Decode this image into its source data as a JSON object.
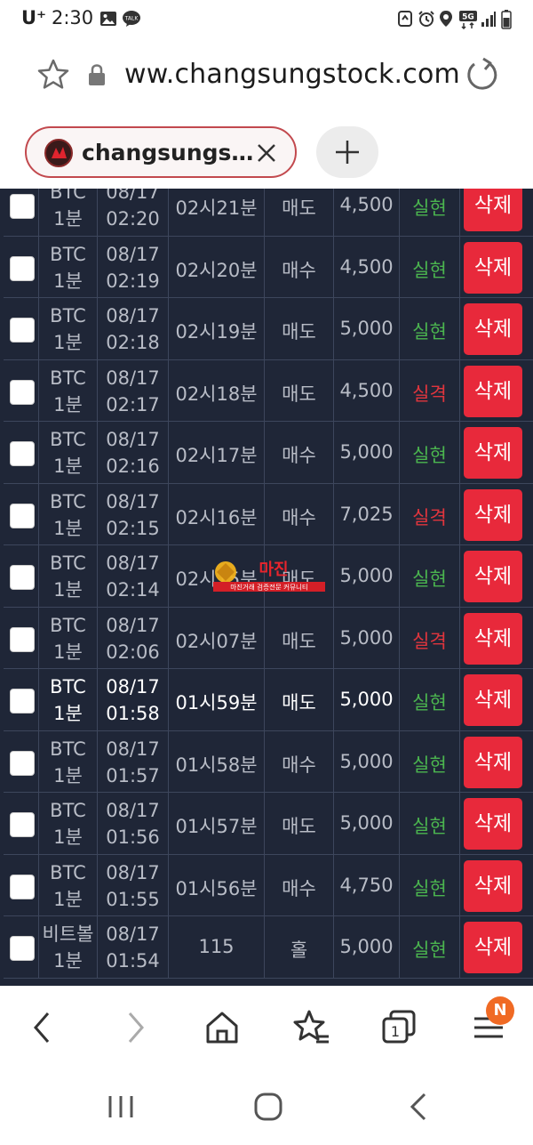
{
  "status_bar": {
    "carrier": "U⁺",
    "time": "2:30",
    "icons": [
      "gallery-icon",
      "talk-icon",
      "sync-icon",
      "alarm-icon",
      "location-icon",
      "5g-icon",
      "signal-icon",
      "battery-icon"
    ],
    "network": "5G"
  },
  "browser": {
    "url": "ww.changsungstock.com",
    "tab_title": "changsungs…"
  },
  "table": {
    "rows": [
      {
        "coin": "BTC",
        "interval": "1분",
        "date": "08/17",
        "time": "02:20",
        "round": "02시21분",
        "position": "매도",
        "amount": "4,500",
        "result": "실현",
        "result_status": "ok",
        "delete": "삭제"
      },
      {
        "coin": "BTC",
        "interval": "1분",
        "date": "08/17",
        "time": "02:19",
        "round": "02시20분",
        "position": "매수",
        "amount": "4,500",
        "result": "실현",
        "result_status": "ok",
        "delete": "삭제"
      },
      {
        "coin": "BTC",
        "interval": "1분",
        "date": "08/17",
        "time": "02:18",
        "round": "02시19분",
        "position": "매도",
        "amount": "5,000",
        "result": "실현",
        "result_status": "ok",
        "delete": "삭제"
      },
      {
        "coin": "BTC",
        "interval": "1분",
        "date": "08/17",
        "time": "02:17",
        "round": "02시18분",
        "position": "매도",
        "amount": "4,500",
        "result": "실격",
        "result_status": "fail",
        "delete": "삭제"
      },
      {
        "coin": "BTC",
        "interval": "1분",
        "date": "08/17",
        "time": "02:16",
        "round": "02시17분",
        "position": "매수",
        "amount": "5,000",
        "result": "실현",
        "result_status": "ok",
        "delete": "삭제"
      },
      {
        "coin": "BTC",
        "interval": "1분",
        "date": "08/17",
        "time": "02:15",
        "round": "02시16분",
        "position": "매수",
        "amount": "7,025",
        "result": "실격",
        "result_status": "fail",
        "delete": "삭제"
      },
      {
        "coin": "BTC",
        "interval": "1분",
        "date": "08/17",
        "time": "02:14",
        "round": "02시15분",
        "position": "매도",
        "amount": "5,000",
        "result": "실현",
        "result_status": "ok",
        "delete": "삭제"
      },
      {
        "coin": "BTC",
        "interval": "1분",
        "date": "08/17",
        "time": "02:06",
        "round": "02시07분",
        "position": "매도",
        "amount": "5,000",
        "result": "실격",
        "result_status": "fail",
        "delete": "삭제"
      },
      {
        "coin": "BTC",
        "interval": "1분",
        "date": "08/17",
        "time": "01:58",
        "round": "01시59분",
        "position": "매도",
        "amount": "5,000",
        "result": "실현",
        "result_status": "ok",
        "delete": "삭제",
        "highlight": true
      },
      {
        "coin": "BTC",
        "interval": "1분",
        "date": "08/17",
        "time": "01:57",
        "round": "01시58분",
        "position": "매수",
        "amount": "5,000",
        "result": "실현",
        "result_status": "ok",
        "delete": "삭제"
      },
      {
        "coin": "BTC",
        "interval": "1분",
        "date": "08/17",
        "time": "01:56",
        "round": "01시57분",
        "position": "매도",
        "amount": "5,000",
        "result": "실현",
        "result_status": "ok",
        "delete": "삭제"
      },
      {
        "coin": "BTC",
        "interval": "1분",
        "date": "08/17",
        "time": "01:55",
        "round": "01시56분",
        "position": "매수",
        "amount": "4,750",
        "result": "실현",
        "result_status": "ok",
        "delete": "삭제"
      },
      {
        "coin": "비트볼",
        "interval": "1분",
        "date": "08/17",
        "time": "01:54",
        "round": "115",
        "position": "홀",
        "amount": "5,000",
        "result": "실현",
        "result_status": "ok",
        "delete": "삭제"
      }
    ]
  },
  "watermark": {
    "title": "마진",
    "subtitle": "마진거래 검증전문 커뮤니티"
  },
  "toolbar": {
    "tab_count": "1",
    "badge": "N"
  },
  "colors": {
    "table_bg": "#1f2637",
    "delete_button": "#e8293b",
    "result_ok": "#4bb54f",
    "result_fail": "#e0353d",
    "tab_border": "#c2494e"
  }
}
